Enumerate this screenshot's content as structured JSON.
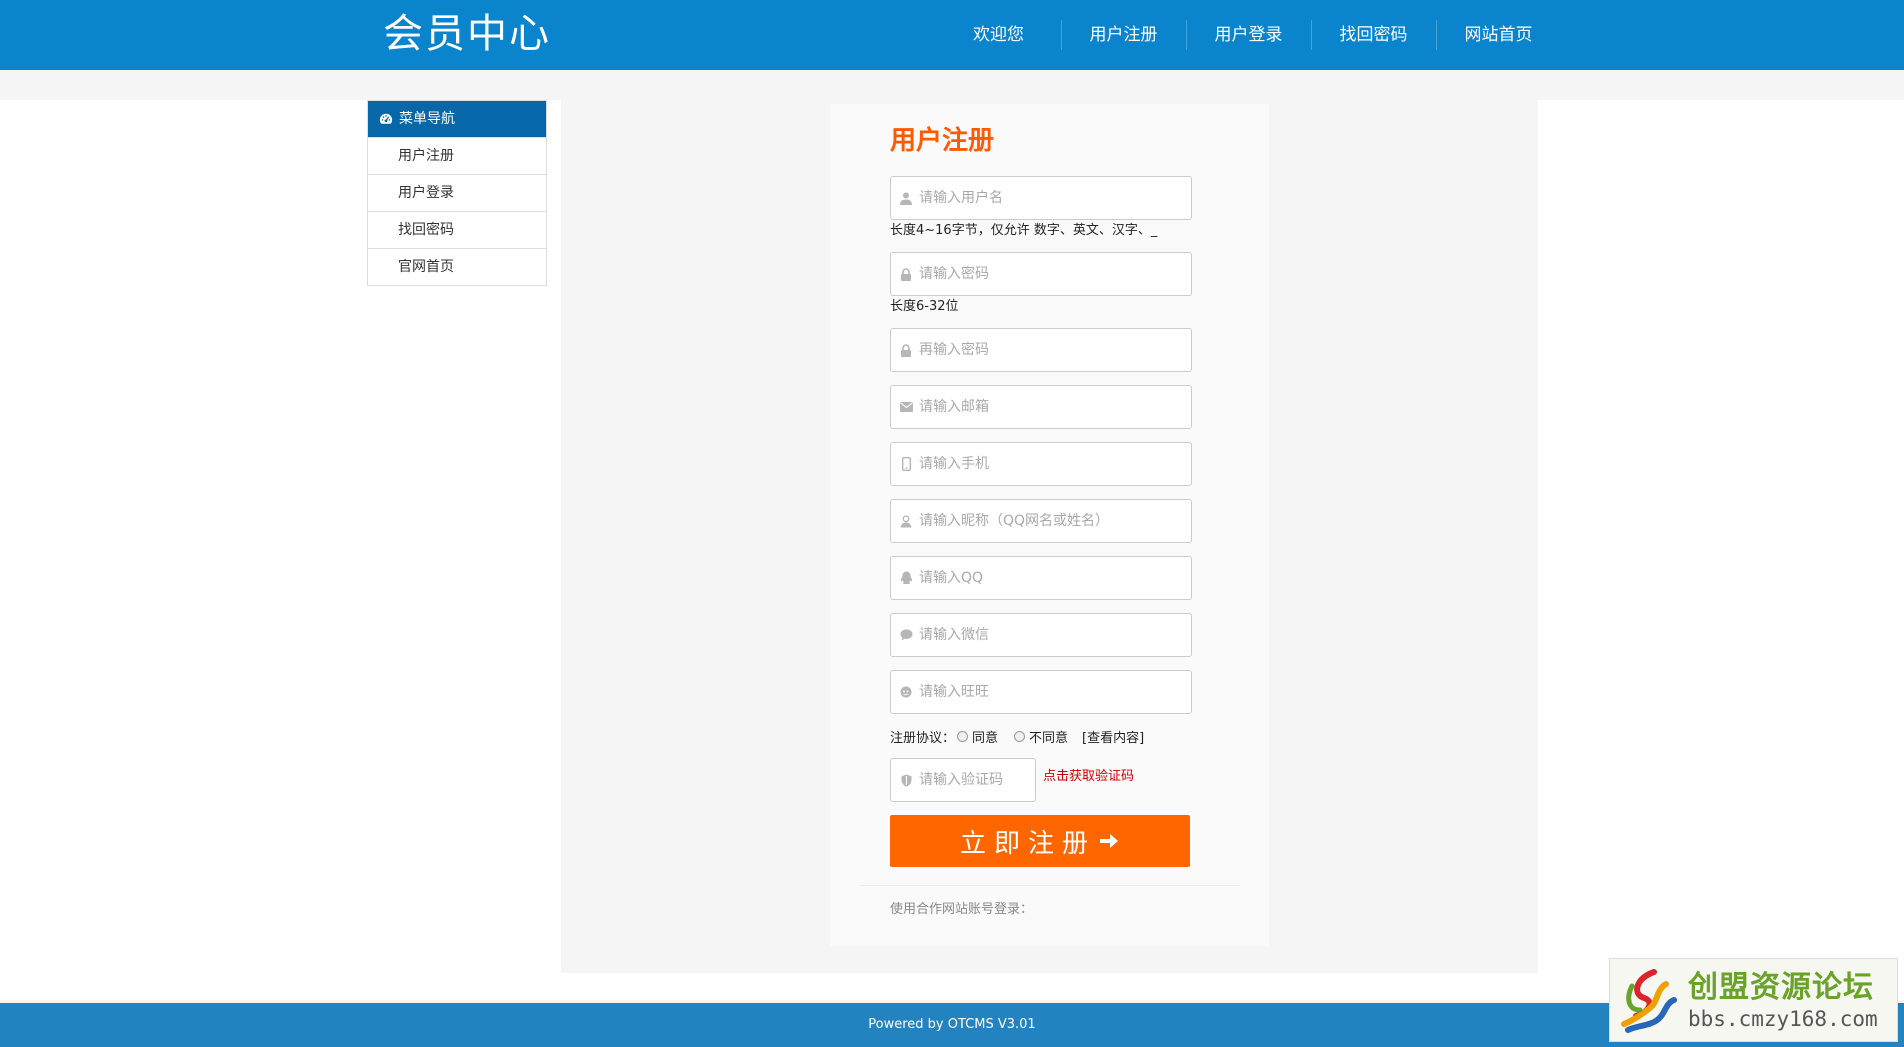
{
  "header": {
    "logo": "会员中心",
    "nav": [
      "欢迎您",
      "用户注册",
      "用户登录",
      "找回密码",
      "网站首页"
    ]
  },
  "sidebar": {
    "title": "菜单导航",
    "items": [
      "用户注册",
      "用户登录",
      "找回密码",
      "官网首页"
    ]
  },
  "form": {
    "title": "用户注册",
    "username_placeholder": "请输入用户名",
    "username_hint": "长度4~16字节，仅允许 数字、英文、汉字、_",
    "password_placeholder": "请输入密码",
    "password_hint": "长度6-32位",
    "password2_placeholder": "再输入密码",
    "email_placeholder": "请输入邮箱",
    "phone_placeholder": "请输入手机",
    "nickname_placeholder": "请输入昵称（QQ网名或姓名）",
    "qq_placeholder": "请输入QQ",
    "wechat_placeholder": "请输入微信",
    "wangwang_placeholder": "请输入旺旺",
    "agreement_label": "注册协议：",
    "agree": "同意",
    "disagree": "不同意",
    "view_content": "[查看内容]",
    "captcha_placeholder": "请输入验证码",
    "captcha_link": "点击获取验证码",
    "submit": "立即注册",
    "partner_login": "使用合作网站账号登录："
  },
  "footer": {
    "text": "Powered by OTCMS V3.01"
  },
  "watermark": {
    "title": "创盟资源论坛",
    "url": "bbs.cmzy168.com"
  },
  "colors": {
    "header": "#0a84cd",
    "sidebar_head": "#0767a8",
    "accent": "#ff6600",
    "title": "#ff5a00",
    "footer": "#2383c0"
  }
}
